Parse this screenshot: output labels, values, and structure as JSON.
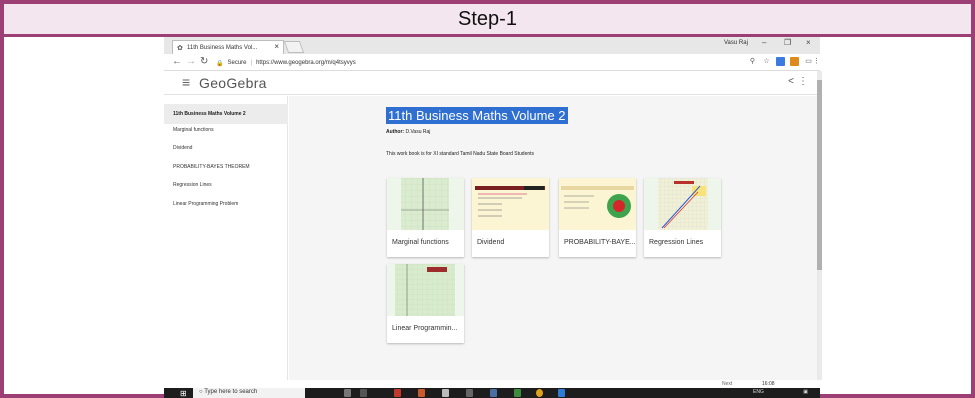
{
  "step_label": "Step-1",
  "browser": {
    "tab_title": "11th Business Maths Vol...",
    "profile": "Vasu Raj",
    "secure_label": "Secure",
    "url": "https://www.geogebra.org/m/q4tsyvys"
  },
  "app": {
    "logo": "GeoGebra"
  },
  "sidebar": {
    "title": "11th Business Maths Volume 2",
    "items": [
      "Marginal functions",
      "Dividend",
      "PROBABILITY-BAYES THEOREM",
      "Regression Lines",
      "Linear Programming Problem"
    ]
  },
  "book": {
    "title": "11th Business Maths Volume 2",
    "author_label": "Author:",
    "author": "D.Vasu Raj",
    "description": "This work book is for XI standard Tamil Nadu State Board Students"
  },
  "cards": [
    {
      "label": "Marginal functions"
    },
    {
      "label": "Dividend"
    },
    {
      "label": "PROBABILITY-BAYE..."
    },
    {
      "label": "Regression Lines"
    },
    {
      "label": "Linear Programmin..."
    }
  ],
  "taskbar": {
    "search_placeholder": "Type here to search",
    "language": "ENG",
    "time": "16:08"
  },
  "footer": {
    "next_label": "Next"
  },
  "colors": {
    "frame": "#9c3f74",
    "highlight": "#2f6fd1"
  }
}
